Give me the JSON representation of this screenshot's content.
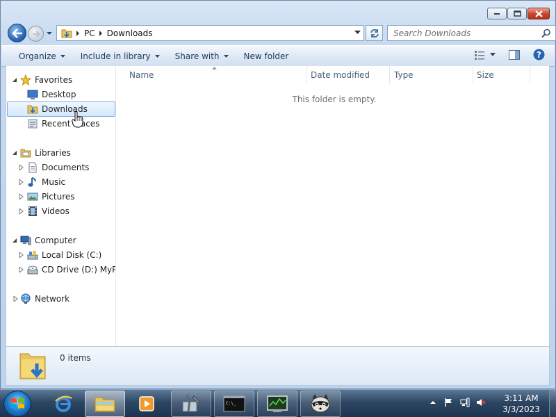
{
  "window": {
    "address": {
      "crumbs": [
        "PC",
        "Downloads"
      ]
    },
    "search": {
      "placeholder": "Search Downloads"
    },
    "toolbar": {
      "organize": "Organize",
      "include_in_library": "Include in library",
      "share_with": "Share with",
      "new_folder": "New folder"
    },
    "nav": {
      "favorites": "Favorites",
      "desktop": "Desktop",
      "downloads": "Downloads",
      "recent_places": "Recent Places",
      "libraries": "Libraries",
      "documents": "Documents",
      "music": "Music",
      "pictures": "Pictures",
      "videos": "Videos",
      "computer": "Computer",
      "local_disk": "Local Disk (C:)",
      "cd_drive": "CD Drive (D:) MyPal",
      "network": "Network"
    },
    "columns": {
      "name": "Name",
      "date_modified": "Date modified",
      "type": "Type",
      "size": "Size"
    },
    "empty_message": "This folder is empty.",
    "details": {
      "item_count": "0 items"
    }
  },
  "taskbar": {
    "clock": {
      "time": "3:11 AM",
      "date": "3/3/2023"
    }
  }
}
